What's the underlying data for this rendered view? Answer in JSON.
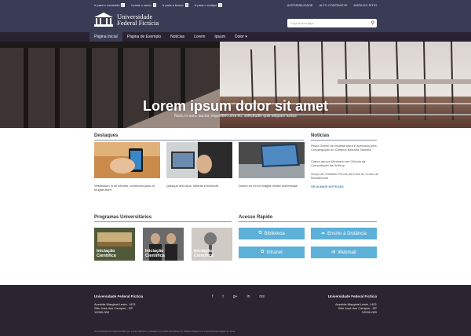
{
  "skip_links": [
    {
      "label": "Ir para o conteúdo",
      "key": "1"
    },
    {
      "label": "Ir para o menu",
      "key": "2"
    },
    {
      "label": "Ir para a busca",
      "key": "3"
    },
    {
      "label": "Ir para o rodapé",
      "key": "4"
    }
  ],
  "utility_links": [
    "ACESSIBILIDADE",
    "ALTO CONTRASTE",
    "MAPA DO SÍTIO"
  ],
  "logo": {
    "line1": "Universidade",
    "line2": "Federal Fictícia"
  },
  "search": {
    "placeholder": "Faça busca aqui ..."
  },
  "nav": [
    "Página Inicial",
    "Página de Exemplo",
    "Notícias",
    "Lorem",
    "Ipsum",
    "Dolor ▾"
  ],
  "hero": {
    "title": "Lorem ipsum dolor sit amet",
    "subtitle": "Nunc in nunc auctor, imperdiet urna eu, sollicitudin quis aliquam luctus"
  },
  "destaques": {
    "title": "Destaques",
    "items": [
      {
        "caption": "Vestibulum in mi lobortis, commodo justo id, feugiat diam"
      },
      {
        "caption": "Quisque nisi risus, lobortis a tincidunt"
      },
      {
        "caption": "Donec eu mi eu magna ornare scelerisque"
      }
    ]
  },
  "noticias": {
    "title": "Notícias",
    "items": [
      "Plano Diretor de Infraestrutura é aprovado pela Congregação do Campus Baixada Santista",
      "Capes aprova Mestrado em Ciência da Computação da Unifesp",
      "Grupo de Trabalho Pervus dá início ao Curso de Nivelamento"
    ],
    "more": "VEJA MAIS NOTÍCIAS"
  },
  "programas": {
    "title": "Programas Universitários",
    "items": [
      "Iniciação Científica",
      "Iniciação Científica",
      "Iniciação Científica"
    ]
  },
  "acesso": {
    "title": "Acesso Rápido",
    "buttons": [
      "Biblioteca",
      "Ensino à Distância",
      "Intranet",
      "Webmail"
    ]
  },
  "footer": {
    "name": "Universidade Federal Fictícia",
    "address": [
      "Avenida Marginal Leste, 1421",
      "São José dos Campos - SP",
      "12000-000"
    ],
    "social": [
      "f",
      "t",
      "g+",
      "in",
      "rss"
    ],
    "credit": "Tema Wordpress desenvolvido por Lucas Sanches, baseado na versão BootStrap do Padrão Digital com a devida autorização do autor."
  },
  "colors": {
    "header": "#3a3b55",
    "nav": "#292233",
    "accent": "#5db0d8",
    "footer": "#2d2431"
  }
}
